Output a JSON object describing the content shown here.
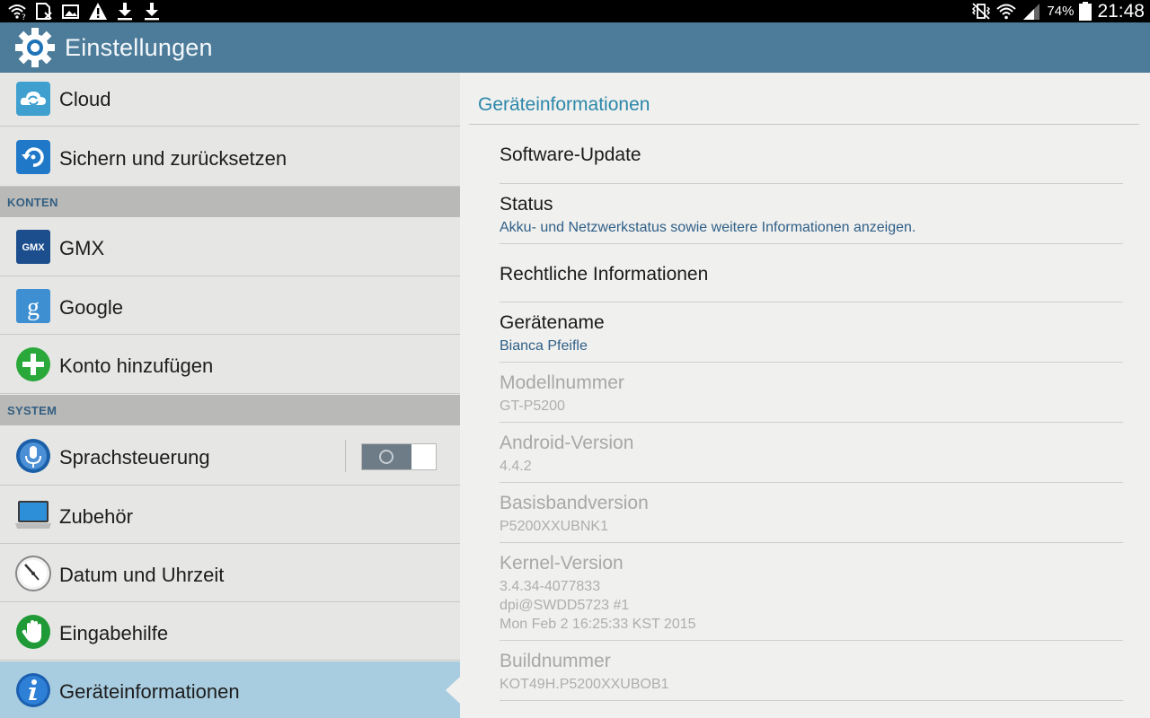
{
  "status_bar": {
    "left_icons": [
      "wifi-question-icon",
      "sim-x-icon",
      "image-icon",
      "warning-icon",
      "download-icon",
      "download-icon"
    ],
    "right_icons": [
      "vibrate-icon",
      "wifi-icon",
      "signal-icon",
      "battery-icon"
    ],
    "battery": "74%",
    "time": "21:48"
  },
  "action_bar": {
    "title": "Einstellungen",
    "icon": "gear-icon"
  },
  "sidebar": {
    "items": [
      {
        "label": "Cloud",
        "icon": "cloud-icon"
      },
      {
        "label": "Sichern und zurücksetzen",
        "icon": "backup-restore-icon"
      },
      {
        "label": "GMX",
        "icon": "gmx-icon"
      },
      {
        "label": "Google",
        "icon": "google-icon"
      },
      {
        "label": "Konto hinzufügen",
        "icon": "add-account-icon"
      },
      {
        "label": "Sprachsteuerung",
        "icon": "microphone-icon"
      },
      {
        "label": "Zubehör",
        "icon": "accessory-icon"
      },
      {
        "label": "Datum und Uhrzeit",
        "icon": "clock-icon"
      },
      {
        "label": "Eingabehilfe",
        "icon": "hand-icon"
      },
      {
        "label": "Geräteinformationen",
        "icon": "info-icon"
      }
    ],
    "sections": {
      "accounts": "KONTEN",
      "system": "SYSTEM"
    },
    "voice_control_toggle": "off"
  },
  "detail": {
    "header": "Geräteinformationen",
    "items": [
      {
        "title": "Software-Update"
      },
      {
        "title": "Status",
        "summary": "Akku- und Netzwerkstatus sowie weitere Informationen anzeigen."
      },
      {
        "title": "Rechtliche Informationen"
      },
      {
        "title": "Gerätename",
        "summary": "Bianca Pfeifle"
      },
      {
        "title": "Modellnummer",
        "summary": "GT-P5200"
      },
      {
        "title": "Android-Version",
        "summary": "4.4.2"
      },
      {
        "title": "Basisbandversion",
        "summary": "P5200XXUBNK1"
      },
      {
        "title": "Kernel-Version",
        "summary_lines": [
          "3.4.34-4077833",
          "dpi@SWDD5723 #1",
          "Mon Feb 2 16:25:33 KST 2015"
        ]
      },
      {
        "title": "Buildnummer",
        "summary": "KOT49H.P5200XXUBOB1"
      }
    ]
  },
  "colors": {
    "action_bar": "#4d7c9a",
    "section_header_text": "#335f82",
    "detail_header": "#2c87a9",
    "selected_item": "#a9cde0"
  }
}
